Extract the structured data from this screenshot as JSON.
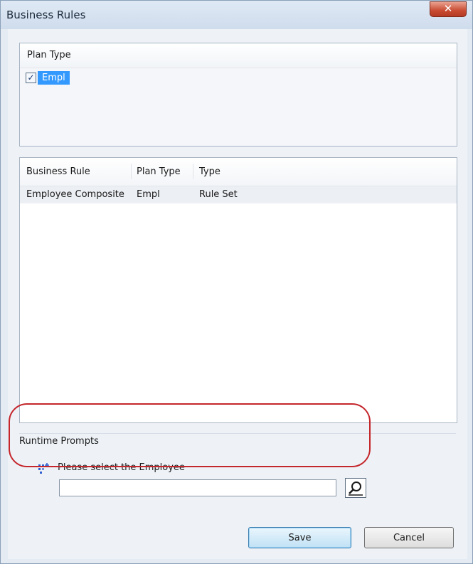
{
  "window": {
    "title": "Business Rules",
    "close_glyph": "✕"
  },
  "plan_type_panel": {
    "header": "Plan Type",
    "items": [
      {
        "label": "Empl",
        "checked": true
      }
    ]
  },
  "rules_table": {
    "columns": [
      "Business Rule",
      "Plan Type",
      "Type"
    ],
    "rows": [
      {
        "rule": "Employee Composite",
        "plan_type": "Empl",
        "type": "Rule Set"
      }
    ]
  },
  "runtime_prompts": {
    "title": "Runtime Prompts",
    "prompt_label": "Please select the Employee",
    "input_value": "",
    "icon": "member-selection-icon",
    "lookup_icon": "magnifier-icon"
  },
  "buttons": {
    "save": "Save",
    "cancel": "Cancel"
  },
  "colors": {
    "highlight_ring": "#c4262b",
    "selection": "#3399ff"
  }
}
